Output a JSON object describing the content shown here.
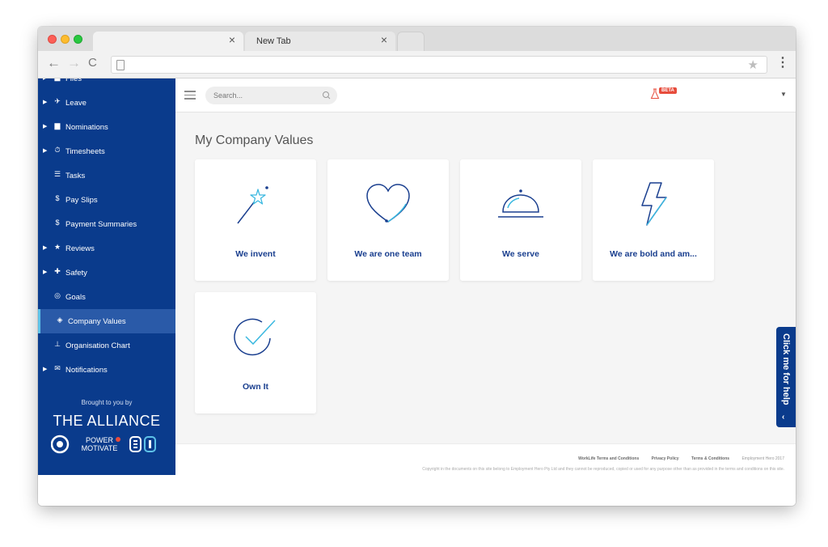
{
  "browser": {
    "tabs": [
      {
        "title": "",
        "close": "×"
      },
      {
        "title": "New Tab",
        "close": "×"
      }
    ],
    "back": "←",
    "forward": "→",
    "reload": "C",
    "star": "★",
    "menu": "⋮"
  },
  "sidebar": {
    "items": [
      {
        "label": "Files",
        "icon": "folder-icon",
        "has_caret": true
      },
      {
        "label": "Leave",
        "icon": "plane-icon",
        "has_caret": true
      },
      {
        "label": "Nominations",
        "icon": "folder-icon",
        "has_caret": true
      },
      {
        "label": "Timesheets",
        "icon": "stopwatch-icon",
        "has_caret": true
      },
      {
        "label": "Tasks",
        "icon": "list-icon",
        "has_caret": false
      },
      {
        "label": "Pay Slips",
        "icon": "dollar-icon",
        "has_caret": false
      },
      {
        "label": "Payment Summaries",
        "icon": "dollar-icon",
        "has_caret": false
      },
      {
        "label": "Reviews",
        "icon": "star-icon",
        "has_caret": true
      },
      {
        "label": "Safety",
        "icon": "first-aid-icon",
        "has_caret": true
      },
      {
        "label": "Goals",
        "icon": "target-icon",
        "has_caret": false
      },
      {
        "label": "Company Values",
        "icon": "gem-icon",
        "has_caret": false,
        "active": true
      },
      {
        "label": "Organisation Chart",
        "icon": "org-chart-icon",
        "has_caret": false
      },
      {
        "label": "Notifications",
        "icon": "envelope-icon",
        "has_caret": true
      }
    ],
    "brought_by": "Brought to you by",
    "brand": "THE ALLIANCE",
    "logo_text_line1": "POWER",
    "logo_text_line2": "MOTIVATE"
  },
  "topbar": {
    "search_placeholder": "Search...",
    "beta": "BETA"
  },
  "main": {
    "title": "My Company Values",
    "values": [
      {
        "label": "We invent",
        "icon": "magic-wand-icon"
      },
      {
        "label": "We are one team",
        "icon": "heart-icon"
      },
      {
        "label": "We serve",
        "icon": "service-bell-icon"
      },
      {
        "label": "We are bold and am...",
        "icon": "lightning-icon"
      },
      {
        "label": "Own It",
        "icon": "check-circle-icon"
      }
    ]
  },
  "footer": {
    "links": [
      "WorkLife Terms and Conditions",
      "Privacy Policy",
      "Terms & Conditions"
    ],
    "credit": "Employment Hero 2017",
    "copyright": "Copyright in the documents on this site belong to Employment Hero Pty Ltd and they cannot be reproduced, copied or used for any purpose other than as provided in the terms and conditions on this site."
  },
  "help": {
    "label": "Click me for help",
    "chevron": "‹"
  },
  "colors": {
    "sidebar": "#0a3b8c",
    "accent": "#5ec2e8",
    "value_label": "#1a3f8f"
  }
}
